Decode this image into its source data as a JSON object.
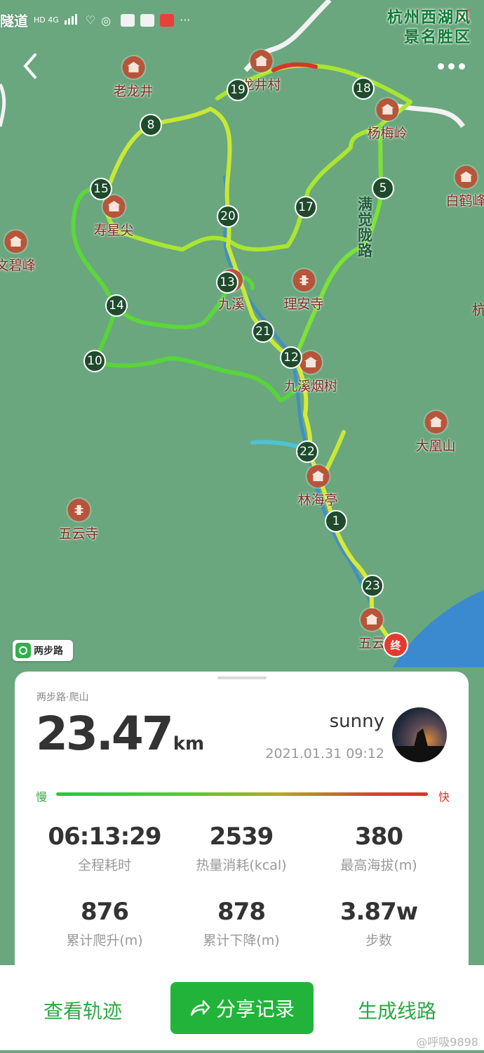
{
  "status_bar": {
    "left_text": "隧道",
    "net": "HD 4G",
    "right_text": "杭州西湖风"
  },
  "area_title": {
    "line1": "杭州西湖风",
    "line2": "景名胜区"
  },
  "map": {
    "pois": [
      {
        "label": "老龙井"
      },
      {
        "label": "龙井村"
      },
      {
        "label": "杨梅岭"
      },
      {
        "label": "白鹤峰"
      },
      {
        "label": "寿星尖"
      },
      {
        "label": "文碧峰"
      },
      {
        "label": "九溪"
      },
      {
        "label": "理安寺"
      },
      {
        "label": "九溪烟树"
      },
      {
        "label": "大凰山"
      },
      {
        "label": "林海亭"
      },
      {
        "label": "五云寺"
      },
      {
        "label": "五云"
      }
    ],
    "road_labels": [
      "满觉陇路",
      "杭"
    ],
    "km_markers": [
      "1",
      "5",
      "8",
      "10",
      "12",
      "13",
      "14",
      "15",
      "17",
      "18",
      "19",
      "20",
      "21",
      "22",
      "23"
    ],
    "end_marker": "终",
    "brand_badge": "两步路",
    "colors": {
      "water": "#3b8ad0",
      "route_fast": "#d8342b",
      "route_slow": "#25c83a",
      "map_bg": "#6aa77f"
    }
  },
  "card": {
    "subtitle": "两步路·爬山",
    "distance_value": "23.47",
    "distance_unit": "km",
    "username": "sunny",
    "datetime": "2021.01.31 09:12",
    "speed_slow_label": "慢",
    "speed_fast_label": "快",
    "stats": [
      {
        "value": "06:13:29",
        "label": "全程耗时"
      },
      {
        "value": "2539",
        "label": "热量消耗(kcal)"
      },
      {
        "value": "380",
        "label": "最高海拔(m)"
      },
      {
        "value": "876",
        "label": "累计爬升(m)"
      },
      {
        "value": "878",
        "label": "累计下降(m)"
      },
      {
        "value": "3.87w",
        "label": "步数"
      }
    ]
  },
  "actions": {
    "view_track": "查看轨迹",
    "share_record": "分享记录",
    "generate_route": "生成线路"
  },
  "watermark": "@呼吸9898"
}
